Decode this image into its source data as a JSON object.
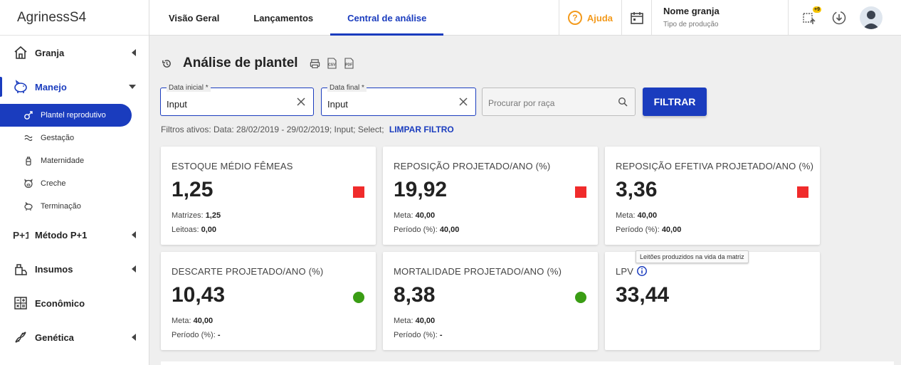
{
  "brand": {
    "name": "Agriness",
    "suffix": " S4"
  },
  "sidebar": {
    "groups": [
      {
        "label": "Granja"
      },
      {
        "label": "Manejo"
      },
      {
        "label": "Método P+1"
      },
      {
        "label": "Insumos"
      },
      {
        "label": "Econômico"
      },
      {
        "label": "Genética"
      }
    ],
    "subitems": [
      {
        "label": "Plantel reprodutivo"
      },
      {
        "label": "Gestação"
      },
      {
        "label": "Maternidade"
      },
      {
        "label": "Creche"
      },
      {
        "label": "Terminação"
      }
    ]
  },
  "topbar": {
    "tabs": [
      {
        "label": "Visão Geral"
      },
      {
        "label": "Lançamentos"
      },
      {
        "label": "Central de análise"
      }
    ],
    "help_label": "Ajuda",
    "farm_name": "Nome granja",
    "farm_type": "Tipo de produção",
    "notification_badge": "+9"
  },
  "page": {
    "title": "Análise de plantel",
    "csv_label": "CSV",
    "pdf_label": "PDF"
  },
  "filters": {
    "start": {
      "label": "Data inicial *",
      "value": "Input"
    },
    "end": {
      "label": "Data final *",
      "value": "Input"
    },
    "search_placeholder": "Procurar por raça",
    "button": "FILTRAR",
    "active_text": "Filtros ativos: Data: 28/02/2019 - 29/02/2019; Input; Select;",
    "clear": "LIMPAR FILTRO"
  },
  "cards": [
    {
      "title": "ESTOQUE MÉDIO FÊMEAS",
      "value": "1,25",
      "status": "red",
      "line1_label": "Matrizes: ",
      "line1_value": "1,25",
      "line2_label": "Leitoas: ",
      "line2_value": "0,00"
    },
    {
      "title": "REPOSIÇÃO PROJETADO/ANO (%)",
      "value": "19,92",
      "status": "red",
      "line1_label": "Meta: ",
      "line1_value": "40,00",
      "line2_label": "Período (%): ",
      "line2_value": "40,00"
    },
    {
      "title": "REPOSIÇÃO EFETIVA PROJETADO/ANO (%)",
      "value": "3,36",
      "status": "red",
      "line1_label": "Meta: ",
      "line1_value": "40,00",
      "line2_label": "Período (%): ",
      "line2_value": "40,00"
    },
    {
      "title": "DESCARTE PROJETADO/ANO (%)",
      "value": "10,43",
      "status": "green",
      "line1_label": "Meta: ",
      "line1_value": "40,00",
      "line2_label": "Período (%): ",
      "line2_value": "-"
    },
    {
      "title": "MORTALIDADE PROJETADO/ANO (%)",
      "value": "8,38",
      "status": "green",
      "line1_label": "Meta: ",
      "line1_value": "40,00",
      "line2_label": "Período (%): ",
      "line2_value": "-"
    },
    {
      "title": "LPV",
      "value": "33,44"
    }
  ],
  "tooltip": "Leitões produzidos na vida da matriz",
  "colors": {
    "primary": "#1a3cbe",
    "help": "#f39a1c",
    "status_red": "#f02b2b",
    "status_green": "#3a9d14"
  }
}
